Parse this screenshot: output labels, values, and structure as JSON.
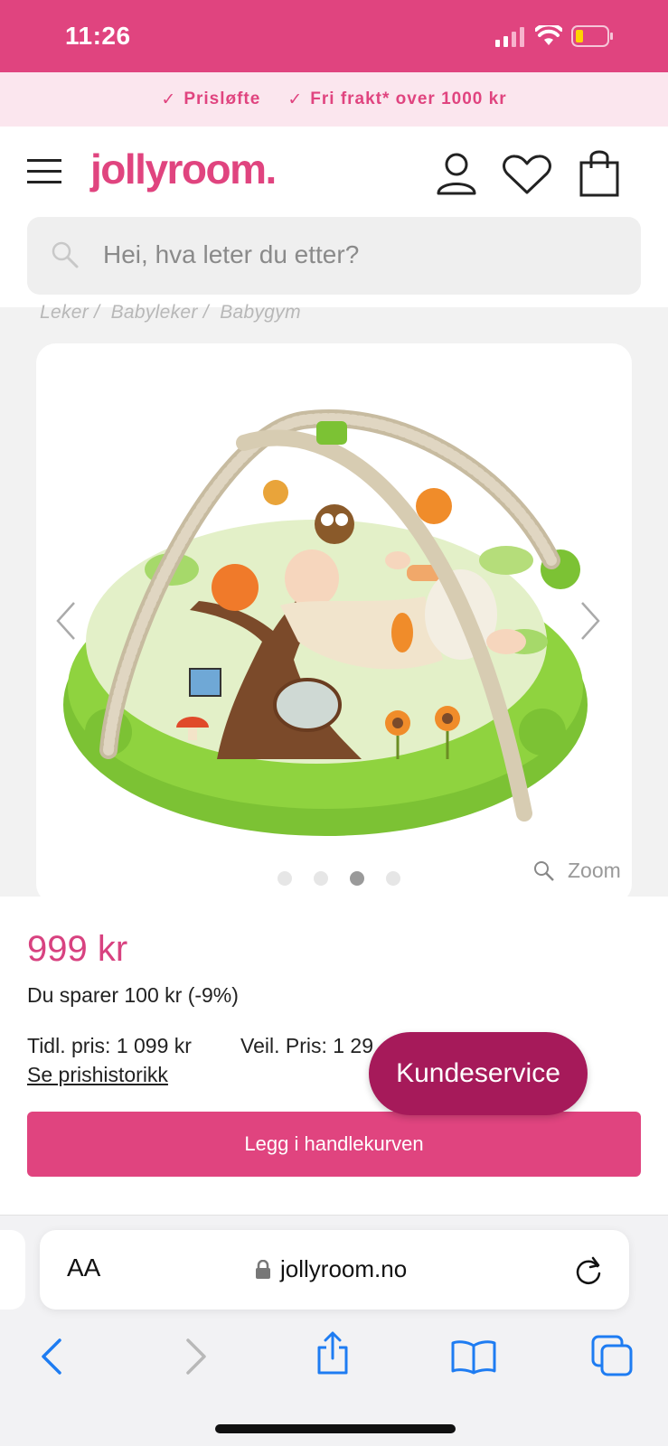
{
  "status_bar": {
    "time": "11:26"
  },
  "promo": {
    "item1": "Prisløfte",
    "item2": "Fri frakt* over 1000 kr"
  },
  "header": {
    "logo": "jollyroom.",
    "search_placeholder": "Hei, hva leter du etter?"
  },
  "breadcrumb": {
    "items": [
      "Leker",
      "Babyleker",
      "Babygym"
    ]
  },
  "gallery": {
    "zoom_label": "Zoom",
    "dot_count": 4,
    "active_dot": 3
  },
  "product": {
    "price": "999 kr",
    "savings": "Du sparer 100 kr (-9%)",
    "previous_price": "Tidl. pris: 1 099 kr",
    "recommended_price": "Veil. Pris: 1 29",
    "price_history_link": "Se prishistorikk",
    "add_to_cart": "Legg i handlekurven"
  },
  "customer_service": {
    "label": "Kundeservice"
  },
  "browser": {
    "text_size": "AA",
    "url": "jollyroom.no"
  },
  "colors": {
    "brand_pink": "#e0447f",
    "service_button": "#a61a5a"
  }
}
